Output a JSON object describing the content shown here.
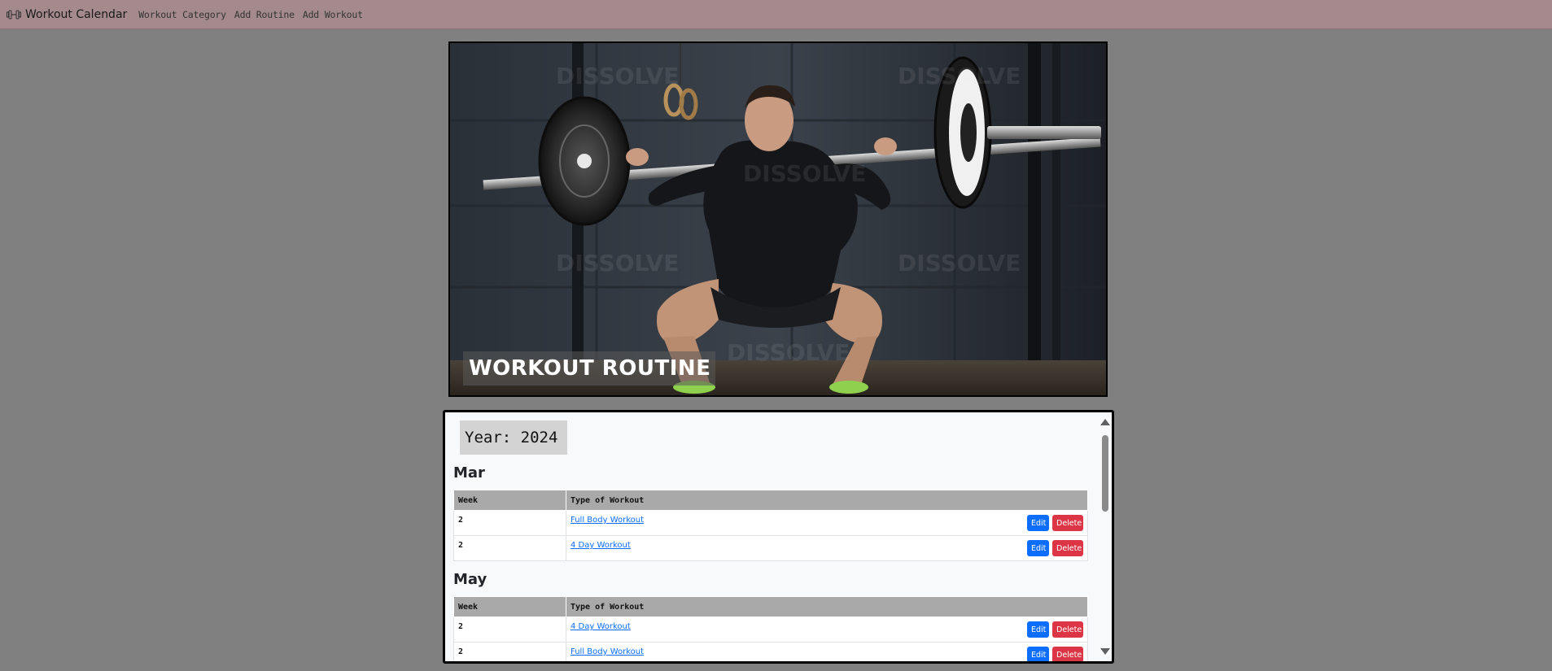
{
  "navbar": {
    "brand": "Workout Calendar",
    "brand_icon": "dumbbell-icon",
    "links": [
      "Workout Category",
      "Add Routine",
      "Add Workout"
    ]
  },
  "hero": {
    "caption": "WORKOUT ROUTINE",
    "watermark": "DISSOLVE"
  },
  "schedule": {
    "year_label": "Year: 2024",
    "columns": [
      "Week",
      "Type of Workout"
    ],
    "edit_label": "Edit",
    "delete_label": "Delete",
    "months": [
      {
        "name": "Mar",
        "rows": [
          {
            "week": "2",
            "workout": "Full Body Workout"
          },
          {
            "week": "2",
            "workout": "4 Day Workout"
          }
        ]
      },
      {
        "name": "May",
        "rows": [
          {
            "week": "2",
            "workout": "4 Day Workout"
          },
          {
            "week": "2",
            "workout": "Full Body Workout"
          }
        ]
      }
    ]
  },
  "colors": {
    "navbar_bg": "#a48a8d",
    "page_bg": "#808080",
    "edit_button": "#0d6efd",
    "delete_button": "#dc3545",
    "table_header": "#a9a9a9"
  }
}
